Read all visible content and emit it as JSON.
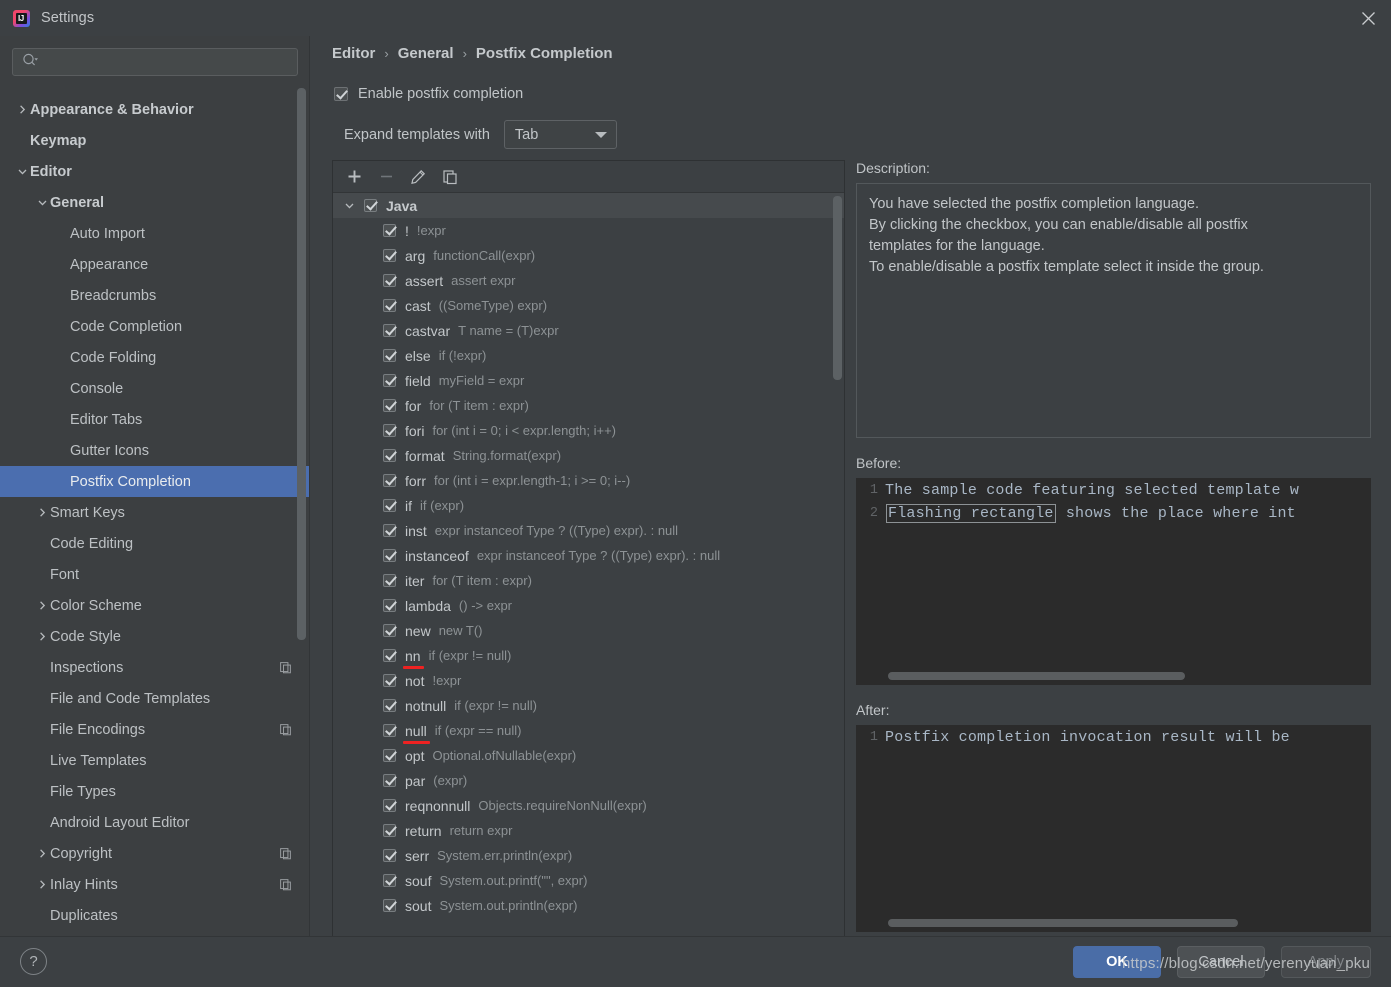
{
  "window": {
    "title": "Settings",
    "logo_icon": "intellij-idea-logo",
    "close_icon": "close-icon"
  },
  "sidebar": {
    "search": {
      "placeholder": "",
      "value": "",
      "icon": "search-icon",
      "dropdown_icon": "caret-down-icon"
    },
    "items": [
      {
        "label": "Appearance & Behavior",
        "arrow": "chevron-right",
        "indent": 0,
        "bold": true,
        "selected": false,
        "copy_icon": false
      },
      {
        "label": "Keymap",
        "arrow": "none",
        "indent": 0,
        "bold": true,
        "selected": false,
        "copy_icon": false
      },
      {
        "label": "Editor",
        "arrow": "chevron-down",
        "indent": 0,
        "bold": true,
        "selected": false,
        "copy_icon": false
      },
      {
        "label": "General",
        "arrow": "chevron-down",
        "indent": 1,
        "bold": true,
        "selected": false,
        "copy_icon": false
      },
      {
        "label": "Auto Import",
        "arrow": "none",
        "indent": 2,
        "bold": false,
        "selected": false,
        "copy_icon": false
      },
      {
        "label": "Appearance",
        "arrow": "none",
        "indent": 2,
        "bold": false,
        "selected": false,
        "copy_icon": false
      },
      {
        "label": "Breadcrumbs",
        "arrow": "none",
        "indent": 2,
        "bold": false,
        "selected": false,
        "copy_icon": false
      },
      {
        "label": "Code Completion",
        "arrow": "none",
        "indent": 2,
        "bold": false,
        "selected": false,
        "copy_icon": false
      },
      {
        "label": "Code Folding",
        "arrow": "none",
        "indent": 2,
        "bold": false,
        "selected": false,
        "copy_icon": false
      },
      {
        "label": "Console",
        "arrow": "none",
        "indent": 2,
        "bold": false,
        "selected": false,
        "copy_icon": false
      },
      {
        "label": "Editor Tabs",
        "arrow": "none",
        "indent": 2,
        "bold": false,
        "selected": false,
        "copy_icon": false
      },
      {
        "label": "Gutter Icons",
        "arrow": "none",
        "indent": 2,
        "bold": false,
        "selected": false,
        "copy_icon": false
      },
      {
        "label": "Postfix Completion",
        "arrow": "none",
        "indent": 2,
        "bold": false,
        "selected": true,
        "copy_icon": false
      },
      {
        "label": "Smart Keys",
        "arrow": "chevron-right",
        "indent": 1,
        "bold": false,
        "selected": false,
        "copy_icon": false
      },
      {
        "label": "Code Editing",
        "arrow": "none",
        "indent": 1,
        "bold": false,
        "selected": false,
        "copy_icon": false
      },
      {
        "label": "Font",
        "arrow": "none",
        "indent": 1,
        "bold": false,
        "selected": false,
        "copy_icon": false
      },
      {
        "label": "Color Scheme",
        "arrow": "chevron-right",
        "indent": 1,
        "bold": false,
        "selected": false,
        "copy_icon": false
      },
      {
        "label": "Code Style",
        "arrow": "chevron-right",
        "indent": 1,
        "bold": false,
        "selected": false,
        "copy_icon": false
      },
      {
        "label": "Inspections",
        "arrow": "none",
        "indent": 1,
        "bold": false,
        "selected": false,
        "copy_icon": true
      },
      {
        "label": "File and Code Templates",
        "arrow": "none",
        "indent": 1,
        "bold": false,
        "selected": false,
        "copy_icon": false
      },
      {
        "label": "File Encodings",
        "arrow": "none",
        "indent": 1,
        "bold": false,
        "selected": false,
        "copy_icon": true
      },
      {
        "label": "Live Templates",
        "arrow": "none",
        "indent": 1,
        "bold": false,
        "selected": false,
        "copy_icon": false
      },
      {
        "label": "File Types",
        "arrow": "none",
        "indent": 1,
        "bold": false,
        "selected": false,
        "copy_icon": false
      },
      {
        "label": "Android Layout Editor",
        "arrow": "none",
        "indent": 1,
        "bold": false,
        "selected": false,
        "copy_icon": false
      },
      {
        "label": "Copyright",
        "arrow": "chevron-right",
        "indent": 1,
        "bold": false,
        "selected": false,
        "copy_icon": true
      },
      {
        "label": "Inlay Hints",
        "arrow": "chevron-right",
        "indent": 1,
        "bold": false,
        "selected": false,
        "copy_icon": true
      },
      {
        "label": "Duplicates",
        "arrow": "none",
        "indent": 1,
        "bold": false,
        "selected": false,
        "copy_icon": false
      }
    ]
  },
  "main": {
    "breadcrumb": [
      "Editor",
      "General",
      "Postfix Completion"
    ],
    "breadcrumb_separator": "›",
    "enable_checkbox": {
      "label": "Enable postfix completion",
      "checked": true
    },
    "expand_with": {
      "label": "Expand templates with",
      "value": "Tab"
    },
    "toolbar": {
      "add_icon": "plus-icon",
      "remove_icon": "minus-icon",
      "edit_icon": "pencil-icon",
      "duplicate_icon": "copy-icon"
    },
    "templates": {
      "group": {
        "label": "Java",
        "checked": true,
        "expanded": true,
        "selected": true
      },
      "items": [
        {
          "key": "!",
          "desc": "!expr",
          "checked": true,
          "underlined": false
        },
        {
          "key": "arg",
          "desc": "functionCall(expr)",
          "checked": true,
          "underlined": false
        },
        {
          "key": "assert",
          "desc": "assert expr",
          "checked": true,
          "underlined": false
        },
        {
          "key": "cast",
          "desc": "((SomeType) expr)",
          "checked": true,
          "underlined": false
        },
        {
          "key": "castvar",
          "desc": "T name = (T)expr",
          "checked": true,
          "underlined": false
        },
        {
          "key": "else",
          "desc": "if (!expr)",
          "checked": true,
          "underlined": false
        },
        {
          "key": "field",
          "desc": "myField = expr",
          "checked": true,
          "underlined": false
        },
        {
          "key": "for",
          "desc": "for (T item : expr)",
          "checked": true,
          "underlined": false
        },
        {
          "key": "fori",
          "desc": "for (int i = 0; i < expr.length; i++)",
          "checked": true,
          "underlined": false
        },
        {
          "key": "format",
          "desc": "String.format(expr)",
          "checked": true,
          "underlined": false
        },
        {
          "key": "forr",
          "desc": "for (int i = expr.length-1; i >= 0; i--)",
          "checked": true,
          "underlined": false
        },
        {
          "key": "if",
          "desc": "if (expr)",
          "checked": true,
          "underlined": false
        },
        {
          "key": "inst",
          "desc": "expr instanceof Type ? ((Type) expr). : null",
          "checked": true,
          "underlined": false
        },
        {
          "key": "instanceof",
          "desc": "expr instanceof Type ? ((Type) expr). : null",
          "checked": true,
          "underlined": false
        },
        {
          "key": "iter",
          "desc": "for (T item : expr)",
          "checked": true,
          "underlined": false
        },
        {
          "key": "lambda",
          "desc": "() -> expr",
          "checked": true,
          "underlined": false
        },
        {
          "key": "new",
          "desc": "new T()",
          "checked": true,
          "underlined": false
        },
        {
          "key": "nn",
          "desc": "if (expr != null)",
          "checked": true,
          "underlined": true
        },
        {
          "key": "not",
          "desc": "!expr",
          "checked": true,
          "underlined": false
        },
        {
          "key": "notnull",
          "desc": "if (expr != null)",
          "checked": true,
          "underlined": false
        },
        {
          "key": "null",
          "desc": "if (expr == null)",
          "checked": true,
          "underlined": true
        },
        {
          "key": "opt",
          "desc": "Optional.ofNullable(expr)",
          "checked": true,
          "underlined": false
        },
        {
          "key": "par",
          "desc": "(expr)",
          "checked": true,
          "underlined": false
        },
        {
          "key": "reqnonnull",
          "desc": "Objects.requireNonNull(expr)",
          "checked": true,
          "underlined": false
        },
        {
          "key": "return",
          "desc": "return expr",
          "checked": true,
          "underlined": false
        },
        {
          "key": "serr",
          "desc": "System.err.println(expr)",
          "checked": true,
          "underlined": false
        },
        {
          "key": "souf",
          "desc": "System.out.printf(\"\", expr)",
          "checked": true,
          "underlined": false
        },
        {
          "key": "sout",
          "desc": "System.out.println(expr)",
          "checked": true,
          "underlined": false
        }
      ]
    },
    "description": {
      "label": "Description:",
      "lines": [
        "You have selected the postfix completion language.",
        "By clicking the checkbox, you can enable/disable all postfix",
        "templates for the language.",
        "To enable/disable a postfix template select it inside the group."
      ]
    },
    "before": {
      "label": "Before:",
      "lines": [
        {
          "num": "1",
          "pre": "The sample code featuring selected template w",
          "boxed": "",
          "post": ""
        },
        {
          "num": "2",
          "pre": " ",
          "boxed": "Flashing rectangle",
          "post": " shows the place where int"
        }
      ]
    },
    "after": {
      "label": "After:",
      "lines": [
        {
          "num": "1",
          "pre": "Postfix completion invocation result will be",
          "boxed": "",
          "post": ""
        }
      ]
    }
  },
  "footer": {
    "help_label": "?",
    "ok_label": "OK",
    "cancel_label": "Cancel",
    "apply_label": "Apply",
    "watermark": "https://blog.csdn.net/yerenyuan_pku"
  },
  "colors": {
    "accent": "#4a6da7",
    "selection": "#4b6eaf",
    "underline": "#ee2222",
    "panel_bg": "#3c4043",
    "code_bg": "#2b2b2b"
  }
}
